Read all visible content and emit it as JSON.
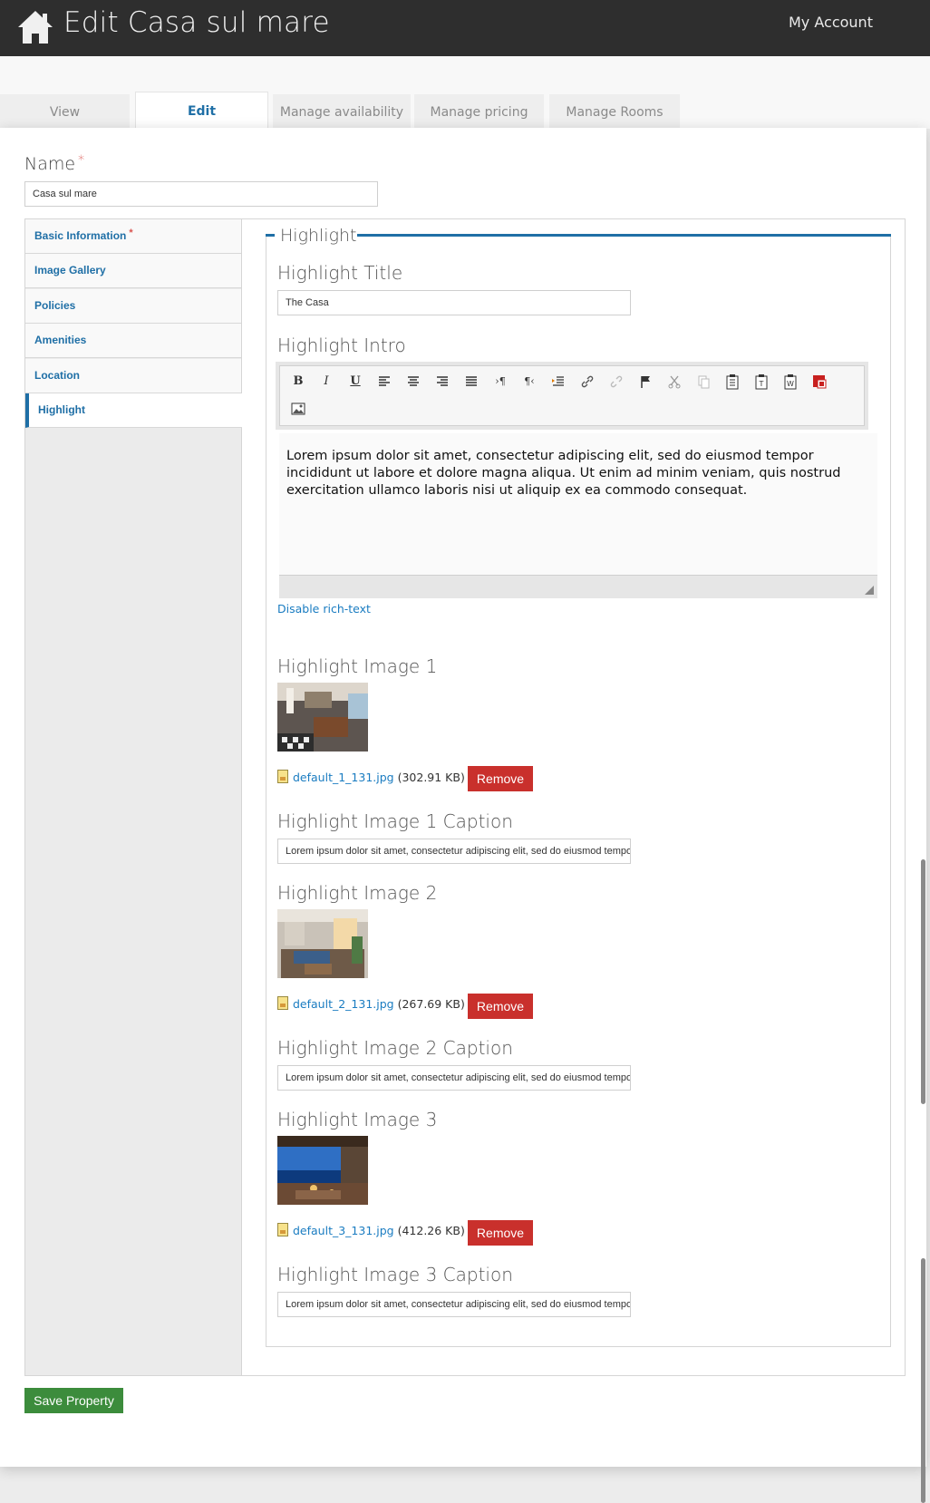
{
  "header": {
    "title": "Edit Casa sul mare",
    "account_label": "My Account",
    "home_icon": "home-icon"
  },
  "tabs": [
    {
      "label": "View",
      "active": false
    },
    {
      "label": "Edit",
      "active": true
    },
    {
      "label": "Manage availability",
      "active": false
    },
    {
      "label": "Manage pricing",
      "active": false
    },
    {
      "label": "Manage Rooms",
      "active": false
    }
  ],
  "form": {
    "name_label": "Name",
    "required_mark": "*",
    "name_value": "Casa sul mare",
    "save_label": "Save Property"
  },
  "sections": [
    {
      "label": "Basic Information",
      "required": true
    },
    {
      "label": "Image Gallery",
      "required": false
    },
    {
      "label": "Policies",
      "required": false
    },
    {
      "label": "Amenities",
      "required": false
    },
    {
      "label": "Location",
      "required": false
    },
    {
      "label": "Highlight",
      "required": false,
      "active": true
    }
  ],
  "highlight": {
    "legend": "Highlight",
    "title_label": "Highlight Title",
    "title_value": "The Casa",
    "intro_label": "Highlight Intro",
    "intro_text": "Lorem ipsum dolor sit amet, consectetur adipiscing elit, sed do eiusmod tempor incididunt ut labore et dolore magna aliqua. Ut enim ad minim veniam, quis nostrud exercitation ullamco laboris nisi ut aliquip ex ea commodo consequat.",
    "toggle_rich_text": "Disable rich-text",
    "toolbar_icons": [
      "bold-icon",
      "italic-icon",
      "underline-icon",
      "align-left-icon",
      "align-center-icon",
      "align-right-icon",
      "justify-icon",
      "ltr-icon",
      "rtl-icon",
      "indent-icon",
      "link-icon",
      "unlink-icon",
      "anchor-flag-icon",
      "cut-icon",
      "copy-icon",
      "paste-icon",
      "paste-text-icon",
      "paste-word-icon",
      "image-icon",
      "picture-icon"
    ],
    "images": [
      {
        "label": "Highlight Image 1",
        "file_name": "default_1_131.jpg",
        "file_size": "(302.91 KB)",
        "remove_label": "Remove",
        "caption_label": "Highlight Image 1 Caption",
        "caption_value": "Lorem ipsum dolor sit amet, consectetur adipiscing elit, sed do eiusmod tempor"
      },
      {
        "label": "Highlight Image 2",
        "file_name": "default_2_131.jpg",
        "file_size": "(267.69 KB)",
        "remove_label": "Remove",
        "caption_label": "Highlight Image 2 Caption",
        "caption_value": "Lorem ipsum dolor sit amet, consectetur adipiscing elit, sed do eiusmod tempor"
      },
      {
        "label": "Highlight Image 3",
        "file_name": "default_3_131.jpg",
        "file_size": "(412.26 KB)",
        "remove_label": "Remove",
        "caption_label": "Highlight Image 3 Caption",
        "caption_value": "Lorem ipsum dolor sit amet, consectetur adipiscing elit, sed do eiusmod tempor"
      }
    ]
  },
  "colors": {
    "header_bg": "#2e2e2e",
    "accent": "#1f6fa6",
    "link": "#1a7cc1",
    "remove": "#c9302c",
    "save": "#3c8c3c",
    "required": "#d9534f"
  }
}
